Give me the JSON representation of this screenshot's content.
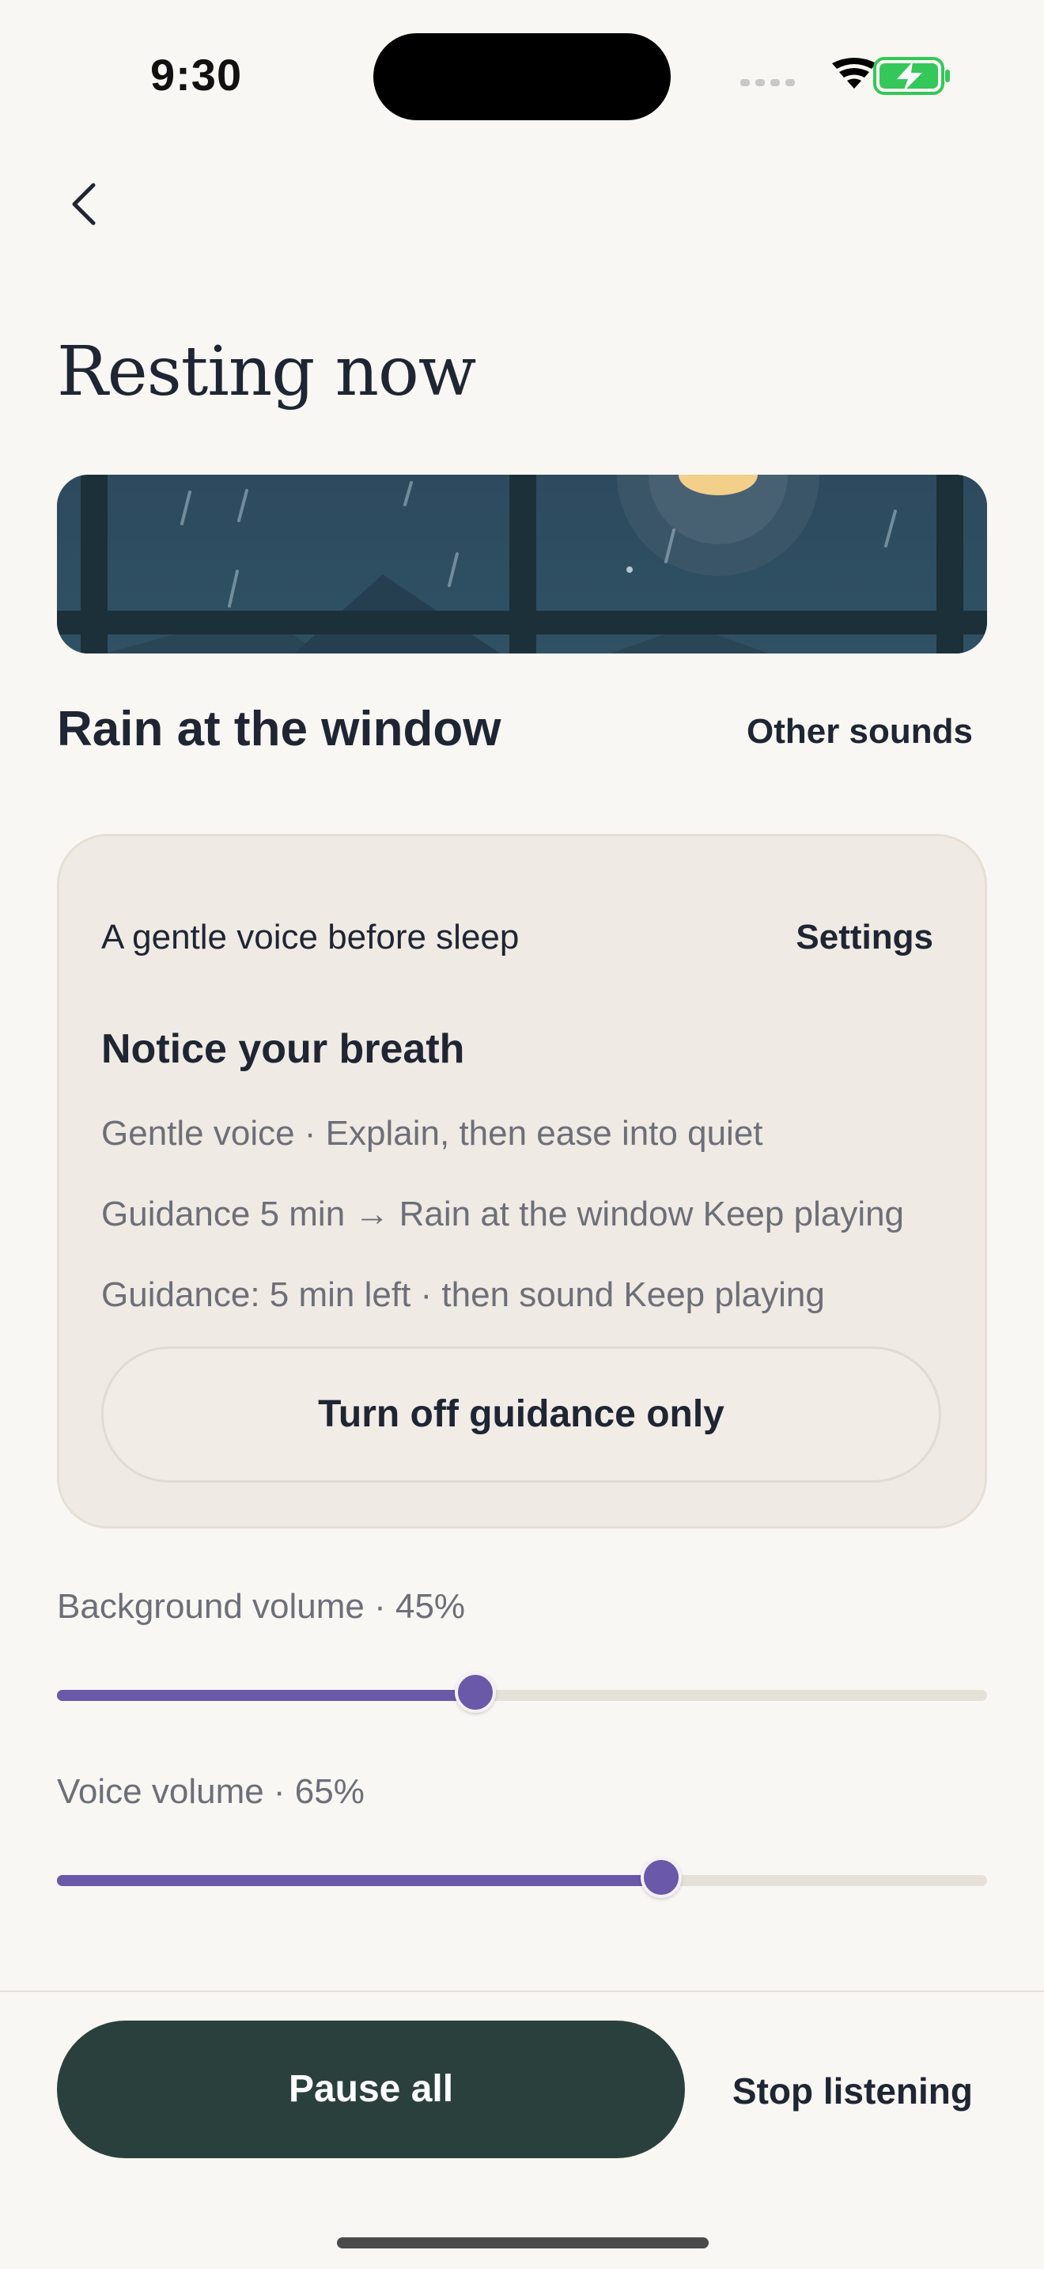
{
  "status_bar": {
    "time": "9:30"
  },
  "header": {
    "title": "Resting now"
  },
  "sound": {
    "name": "Rain at the window",
    "other_sounds_label": "Other sounds"
  },
  "guidance_card": {
    "subtitle": "A gentle voice before sleep",
    "settings_label": "Settings",
    "title": "Notice your breath",
    "line1": "Gentle voice · Explain, then ease into quiet",
    "line2": "Guidance 5 min → Rain at the window Keep playing",
    "line3": "Guidance: 5 min left · then sound Keep playing",
    "button_label": "Turn off guidance only"
  },
  "volumes": {
    "background": {
      "label": "Background volume · 45%",
      "value": 0.45
    },
    "voice": {
      "label": "Voice volume · 65%",
      "value": 0.65
    }
  },
  "footer": {
    "pause_label": "Pause all",
    "stop_label": "Stop listening"
  },
  "colors": {
    "accent": "#6a58a8",
    "primary_button": "#2a403d",
    "battery": "#34c759"
  },
  "icons": [
    "back-chevron-icon",
    "wifi-icon",
    "battery-charging-icon",
    "cellular-icon"
  ]
}
